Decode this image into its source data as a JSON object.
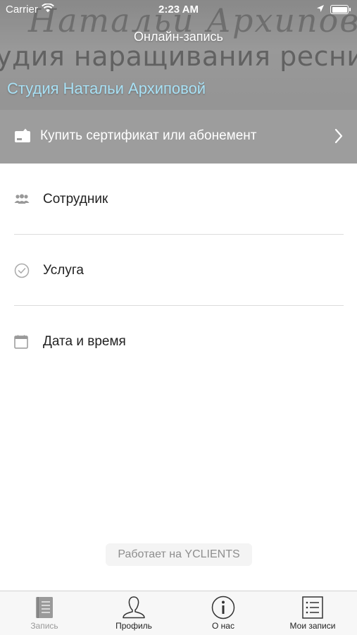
{
  "statusbar": {
    "carrier": "Carrier",
    "time": "2:23 AM"
  },
  "header": {
    "title": "Онлайн-запись",
    "studio_name": "Студия Натальи Архиповой"
  },
  "certificate": {
    "label": "Купить сертификат или абонемент",
    "icon": "certificate-icon"
  },
  "menu": [
    {
      "label": "Сотрудник",
      "icon": "staff-icon"
    },
    {
      "label": "Услуга",
      "icon": "check-circle-icon"
    },
    {
      "label": "Дата и время",
      "icon": "calendar-icon"
    }
  ],
  "powered_by": "Работает на YCLIENTS",
  "tabs": [
    {
      "label": "Запись",
      "icon": "book-icon",
      "active": true
    },
    {
      "label": "Профиль",
      "icon": "profile-icon",
      "active": false
    },
    {
      "label": "О нас",
      "icon": "info-icon",
      "active": false
    },
    {
      "label": "Мои записи",
      "icon": "list-icon",
      "active": false
    }
  ],
  "colors": {
    "studio_name": "#a8e1f5",
    "cert_bar": "#9d9d9d",
    "active_tab": "#9a9a9a"
  }
}
